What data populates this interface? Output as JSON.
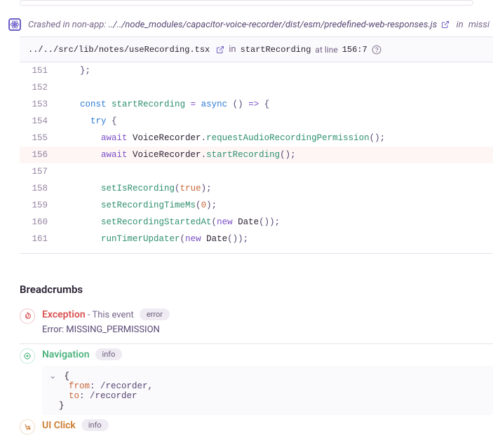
{
  "crashed_banner": {
    "prefix": "Crashed in non-app: ",
    "filepath": "../../node_modules/capacitor-voice-recorder/dist/esm/predefined-web-responses.js",
    "in": "in",
    "func": "missi"
  },
  "frame": {
    "path": "../../src/lib/notes/useRecording.tsx",
    "in": "in",
    "func": "startRecording",
    "atline": "at line",
    "loc": "156:7"
  },
  "code": {
    "lines": [
      "151",
      "152",
      "153",
      "154",
      "155",
      "156",
      "157",
      "158",
      "159",
      "160",
      "161"
    ],
    "tokens": {
      "close_brace": "};",
      "l153": {
        "const": "const",
        "name": "startRecording",
        "eq": "=",
        "async": "async",
        "paren": "()",
        "arrow": "=>",
        "open": "{"
      },
      "l154": {
        "try": "try",
        "open": "{"
      },
      "l155": {
        "await": "await",
        "obj": "VoiceRecorder",
        "dot": ".",
        "method": "requestAudioRecordingPermission",
        "call": "();"
      },
      "l156": {
        "await": "await",
        "obj": "VoiceRecorder",
        "dot": ".",
        "method": "startRecording",
        "call": "();"
      },
      "l158": {
        "fn": "setIsRecording",
        "open": "(",
        "val": "true",
        "close": ");"
      },
      "l159": {
        "fn": "setRecordingTimeMs",
        "open": "(",
        "val": "0",
        "close": ");"
      },
      "l160": {
        "fn": "setRecordingStartedAt",
        "open": "(",
        "new": "new",
        "date": "Date",
        "close": "());"
      },
      "l161": {
        "fn": "runTimerUpdater",
        "open": "(",
        "new": "new",
        "date": "Date",
        "close": "());"
      }
    }
  },
  "breadcrumbs_title": "Breadcrumbs",
  "bc_exception": {
    "title": "Exception",
    "sep": " - ",
    "sub": "This event",
    "badge": "error",
    "msg": "Error: MISSING_PERMISSION"
  },
  "bc_nav": {
    "title": "Navigation",
    "badge": "info",
    "data": {
      "from_k": "from",
      "from_v": "/recorder",
      "to_k": "to",
      "to_v": "/recorder"
    }
  },
  "bc_click": {
    "title": "UI Click",
    "badge": "info"
  }
}
